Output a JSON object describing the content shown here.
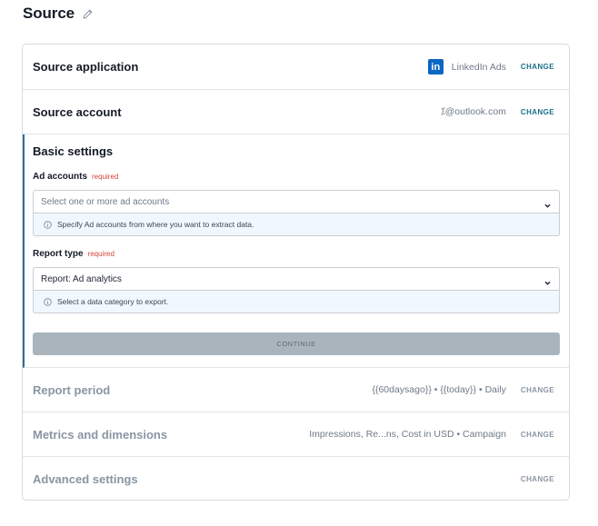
{
  "page": {
    "title": "Source"
  },
  "source_application": {
    "label": "Source application",
    "value": "LinkedIn Ads",
    "logo_text": "in",
    "change": "CHANGE"
  },
  "source_account": {
    "label": "Source account",
    "value": "⁒@outlook.com",
    "change": "CHANGE"
  },
  "basic_settings": {
    "title": "Basic settings",
    "ad_accounts": {
      "label": "Ad accounts",
      "required": "required",
      "placeholder": "Select one or more ad accounts",
      "hint": "Specify Ad accounts from where you want to extract data."
    },
    "report_type": {
      "label": "Report type",
      "required": "required",
      "value": "Report: Ad analytics",
      "hint": "Select a data category to export."
    },
    "continue": "CONTINUE"
  },
  "report_period": {
    "label": "Report period",
    "value": "{{60daysago}} • {{today}} • Daily",
    "change": "CHANGE"
  },
  "metrics": {
    "label": "Metrics and dimensions",
    "value": "Impressions, Re...ns, Cost in USD • Campaign",
    "change": "CHANGE"
  },
  "advanced": {
    "label": "Advanced settings",
    "change": "CHANGE"
  },
  "colors": {
    "accent": "#1a6e8c",
    "active_border": "#2f6b96",
    "required": "#d0463b",
    "linkedin": "#0a66c2",
    "continue_bg": "#aab4bc"
  },
  "icons": [
    "pencil-icon",
    "linkedin-logo",
    "chevron-down-icon",
    "info-icon"
  ]
}
